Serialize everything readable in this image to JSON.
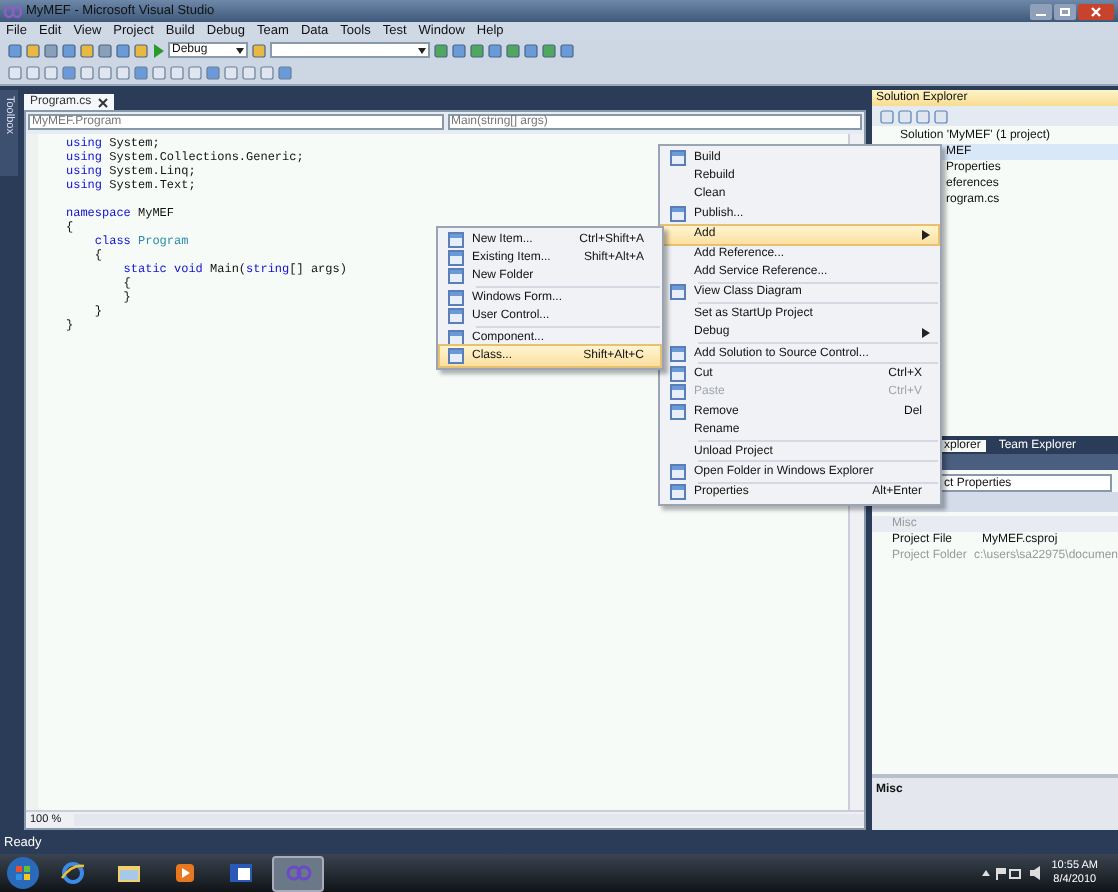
{
  "window": {
    "title": "MyMEF - Microsoft Visual Studio"
  },
  "menu_bar": [
    "File",
    "Edit",
    "View",
    "Project",
    "Build",
    "Debug",
    "Team",
    "Data",
    "Tools",
    "Test",
    "Window",
    "Help"
  ],
  "toolbar": {
    "configuration": "Debug"
  },
  "toolbox_tab": "Toolbox",
  "editor": {
    "tabs": [
      {
        "label": "Program.cs",
        "selected": true
      }
    ],
    "type_selector": "MyMEF.Program",
    "member_selector": "Main(string[] args)",
    "code_blocks": [
      [
        {
          "tokens": [
            {
              "kind": "keyword",
              "text": "using"
            },
            {
              "kind": "plain",
              "text": " System;"
            }
          ]
        },
        {
          "tokens": [
            {
              "kind": "keyword",
              "text": "using"
            },
            {
              "kind": "plain",
              "text": " System.Collections.Generic;"
            }
          ]
        },
        {
          "tokens": [
            {
              "kind": "keyword",
              "text": "using"
            },
            {
              "kind": "plain",
              "text": " System.Linq;"
            }
          ]
        },
        {
          "tokens": [
            {
              "kind": "keyword",
              "text": "using"
            },
            {
              "kind": "plain",
              "text": " System.Text;"
            }
          ]
        }
      ],
      [
        {
          "tokens": [
            {
              "kind": "keyword",
              "text": "namespace"
            },
            {
              "kind": "plain",
              "text": " MyMEF"
            }
          ]
        },
        {
          "tokens": [
            {
              "kind": "plain",
              "text": "{"
            }
          ]
        },
        {
          "tokens": [
            {
              "kind": "keyword",
              "text": "    class"
            },
            {
              "kind": "type",
              "text": " Program"
            }
          ]
        },
        {
          "tokens": [
            {
              "kind": "plain",
              "text": "    {"
            }
          ]
        },
        {
          "tokens": [
            {
              "kind": "keyword",
              "text": "        static void"
            },
            {
              "kind": "plain",
              "text": " Main("
            },
            {
              "kind": "keyword",
              "text": "string"
            },
            {
              "kind": "plain",
              "text": "[] args)"
            }
          ]
        },
        {
          "tokens": [
            {
              "kind": "plain",
              "text": "        {"
            }
          ]
        },
        {
          "tokens": [
            {
              "kind": "plain",
              "text": "        }"
            }
          ]
        },
        {
          "tokens": [
            {
              "kind": "plain",
              "text": "    }"
            }
          ]
        },
        {
          "tokens": [
            {
              "kind": "plain",
              "text": "}"
            }
          ]
        }
      ]
    ],
    "zoom": "100 %"
  },
  "solution_explorer": {
    "title": "Solution Explorer",
    "tree": [
      {
        "label": "Solution 'MyMEF' (1 project)",
        "selected": false,
        "children": [
          {
            "label": "MEF",
            "selected": true,
            "children": [
              {
                "label": "Properties",
                "selected": false
              },
              {
                "label": "eferences",
                "selected": false
              },
              {
                "label": "rogram.cs",
                "selected": false
              }
            ]
          }
        ]
      }
    ]
  },
  "panel_tabs": [
    {
      "label": "xplorer",
      "selected": true
    },
    {
      "label": "Team Explorer",
      "selected": false
    }
  ],
  "properties": {
    "object": "ct Properties",
    "category": "Misc",
    "rows": [
      {
        "name": "Project File",
        "value": "MyMEF.csproj",
        "disabled": false
      },
      {
        "name": "Project Folder",
        "value": "c:\\users\\sa22975\\documen",
        "disabled": true
      }
    ],
    "description_title": "Misc"
  },
  "context_menu": {
    "items": [
      {
        "kind": "item",
        "label": "Build",
        "icon": true,
        "selected": false,
        "disabled": false,
        "submenu": false
      },
      {
        "kind": "item",
        "label": "Rebuild",
        "icon": false,
        "selected": false,
        "disabled": false,
        "submenu": false
      },
      {
        "kind": "item",
        "label": "Clean",
        "icon": false,
        "selected": false,
        "disabled": false,
        "submenu": false
      },
      {
        "kind": "item",
        "label": "Publish...",
        "icon": true,
        "selected": false,
        "disabled": false,
        "submenu": false
      },
      {
        "kind": "separator"
      },
      {
        "kind": "item",
        "label": "Add",
        "icon": false,
        "selected": true,
        "disabled": false,
        "submenu": true
      },
      {
        "kind": "item",
        "label": "Add Reference...",
        "icon": false,
        "selected": false,
        "disabled": false,
        "submenu": false
      },
      {
        "kind": "item",
        "label": "Add Service Reference...",
        "icon": false,
        "selected": false,
        "disabled": false,
        "submenu": false
      },
      {
        "kind": "separator"
      },
      {
        "kind": "item",
        "label": "View Class Diagram",
        "icon": true,
        "selected": false,
        "disabled": false,
        "submenu": false
      },
      {
        "kind": "separator"
      },
      {
        "kind": "item",
        "label": "Set as StartUp Project",
        "icon": false,
        "selected": false,
        "disabled": false,
        "submenu": false
      },
      {
        "kind": "item",
        "label": "Debug",
        "icon": false,
        "selected": false,
        "disabled": false,
        "submenu": true
      },
      {
        "kind": "separator"
      },
      {
        "kind": "item",
        "label": "Add Solution to Source Control...",
        "icon": true,
        "selected": false,
        "disabled": false,
        "submenu": false
      },
      {
        "kind": "separator"
      },
      {
        "kind": "item",
        "label": "Cut",
        "shortcut": "Ctrl+X",
        "icon": true,
        "selected": false,
        "disabled": false,
        "submenu": false
      },
      {
        "kind": "item",
        "label": "Paste",
        "shortcut": "Ctrl+V",
        "icon": true,
        "selected": false,
        "disabled": true,
        "submenu": false
      },
      {
        "kind": "item",
        "label": "Remove",
        "shortcut": "Del",
        "icon": true,
        "selected": false,
        "disabled": false,
        "submenu": false
      },
      {
        "kind": "item",
        "label": "Rename",
        "icon": false,
        "selected": false,
        "disabled": false,
        "submenu": false
      },
      {
        "kind": "separator"
      },
      {
        "kind": "item",
        "label": "Unload Project",
        "icon": false,
        "selected": false,
        "disabled": false,
        "submenu": false
      },
      {
        "kind": "separator"
      },
      {
        "kind": "item",
        "label": "Open Folder in Windows Explorer",
        "icon": true,
        "selected": false,
        "disabled": false,
        "submenu": false
      },
      {
        "kind": "separator"
      },
      {
        "kind": "item",
        "label": "Properties",
        "shortcut": "Alt+Enter",
        "icon": true,
        "selected": false,
        "disabled": false,
        "submenu": false
      }
    ]
  },
  "submenu": {
    "items": [
      {
        "kind": "item",
        "label": "New Item...",
        "shortcut": "Ctrl+Shift+A",
        "icon": true,
        "selected": false,
        "disabled": false,
        "submenu": false
      },
      {
        "kind": "item",
        "label": "Existing Item...",
        "shortcut": "Shift+Alt+A",
        "icon": true,
        "selected": false,
        "disabled": false,
        "submenu": false
      },
      {
        "kind": "item",
        "label": "New Folder",
        "icon": true,
        "selected": false,
        "disabled": false,
        "submenu": false
      },
      {
        "kind": "separator"
      },
      {
        "kind": "item",
        "label": "Windows Form...",
        "icon": true,
        "selected": false,
        "disabled": false,
        "submenu": false
      },
      {
        "kind": "item",
        "label": "User Control...",
        "icon": true,
        "selected": false,
        "disabled": false,
        "submenu": false
      },
      {
        "kind": "separator"
      },
      {
        "kind": "item",
        "label": "Component...",
        "icon": true,
        "selected": false,
        "disabled": false,
        "submenu": false
      },
      {
        "kind": "item",
        "label": "Class...",
        "shortcut": "Shift+Alt+C",
        "icon": true,
        "selected": true,
        "disabled": false,
        "submenu": false
      }
    ]
  },
  "status_bar": "Ready",
  "taskbar": {
    "apps": [
      {
        "selected": false
      },
      {
        "selected": false
      },
      {
        "selected": false
      },
      {
        "selected": false
      },
      {
        "selected": true
      }
    ],
    "time": "10:55 AM",
    "date": "8/4/2010"
  }
}
